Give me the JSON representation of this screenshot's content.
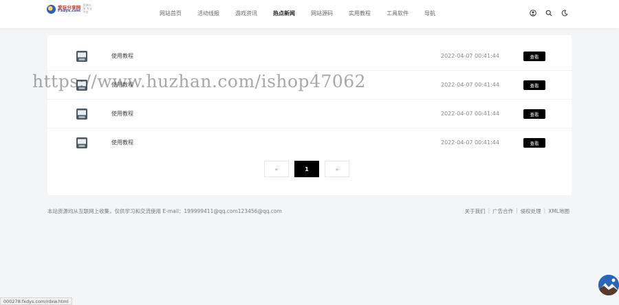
{
  "header": {
    "logo": {
      "cn": "爱玩分享网",
      "en": "Fxdys.com",
      "slogan": "资源分享 专业平台"
    },
    "nav": [
      "网站首页",
      "活动线报",
      "游戏资讯",
      "热点新闻",
      "网站源码",
      "实用教程",
      "工具软件",
      "导航"
    ],
    "active_nav": "热点新闻",
    "icons": [
      "user-icon",
      "search-icon",
      "moon-icon"
    ]
  },
  "list": [
    {
      "title": "使用教程",
      "date": "2022-04-07 00:41:44",
      "button": "查看"
    },
    {
      "title": "使用教程",
      "date": "2022-04-07 00:41:44",
      "button": "查看"
    },
    {
      "title": "使用教程",
      "date": "2022-04-07 00:41:44",
      "button": "查看"
    },
    {
      "title": "使用教程",
      "date": "2022-04-07 00:41:44",
      "button": "查看"
    }
  ],
  "pagination": {
    "prev": "«",
    "current": "1",
    "next": "»"
  },
  "footer": {
    "notice": "本站资源均从互联网上收集，仅供学习和交流使用 E-mail：199999411@qq.com123456@qq.com",
    "links": [
      "关于我们",
      "广告合作",
      "侵权处理",
      "XML地图"
    ]
  },
  "watermark": "https://www.huzhan.com/ishop47062",
  "status_url": "000278.fxdys.com/rdxw.html",
  "colors": {
    "background": "#f4f5f7",
    "accent": "#000000"
  }
}
